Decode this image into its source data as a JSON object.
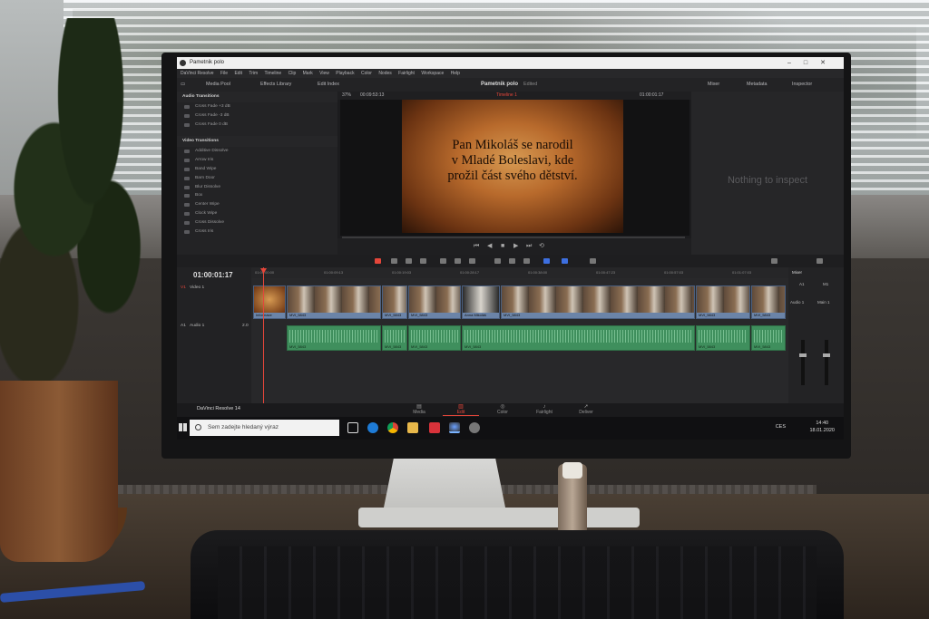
{
  "app": {
    "window_title": "Pametnik polo",
    "project_name": "Pametnik polo",
    "project_status": "Edited",
    "app_name": "DaVinci Resolve 14"
  },
  "menu": [
    "DaVinci Resolve",
    "File",
    "Edit",
    "Trim",
    "Timeline",
    "Clip",
    "Mark",
    "View",
    "Playback",
    "Color",
    "Nodes",
    "Fairlight",
    "Workspace",
    "Help"
  ],
  "toolbar": {
    "media_pool": "Media Pool",
    "effects_library": "Effects Library",
    "edit_index": "Edit Index",
    "mixer": "Mixer",
    "metadata": "Metadata",
    "inspector": "Inspector"
  },
  "effects": {
    "audio_heading": "Audio Transitions",
    "audio_items": [
      "Cross Fade +3 dB",
      "Cross Fade -3 dB",
      "Cross Fade 0 dB"
    ],
    "video_heading": "Video Transitions",
    "video_items": [
      "Additive Dissolve",
      "Arrow Iris",
      "Band Wipe",
      "Barn Door",
      "Blur Dissolve",
      "Box",
      "Center Wipe",
      "Clock Wipe",
      "Cross Dissolve",
      "Cross Iris"
    ]
  },
  "viewer": {
    "zoom": "37%",
    "source_timecode": "00:09:53:13",
    "timeline_name": "Timeline 1",
    "record_timecode": "01:00:01:17",
    "frame_text": [
      "Pan Mikoláš se narodil",
      "v Mladé Boleslavi, kde",
      "prožil část svého dětství."
    ]
  },
  "inspector": {
    "empty_text": "Nothing to inspect"
  },
  "timeline": {
    "timecode": "01:00:01:17",
    "video_track": "Video 1",
    "video_track_id": "V1",
    "audio_track": "Audio 1",
    "audio_track_id": "A1",
    "audio_track_level": "2.0",
    "ruler": [
      "01:00:00:00",
      "01:00:09:13",
      "01:00:19:03",
      "01:00:28:17",
      "01:00:38:00",
      "01:00:47:23",
      "01:00:57:03",
      "01:01:07:03"
    ],
    "video_clips": [
      "Informace",
      "MVI_5843",
      "MVI_5843",
      "MVI_5843",
      "Anna Mikoláš",
      "MVI_5843",
      "MVI_5843",
      "MVI_5843"
    ],
    "audio_clips": [
      "MVI_5843",
      "MVI_5843",
      "MVI_5843",
      "MVI_5843",
      "MVI_5843",
      "MVI_5843"
    ]
  },
  "mixer": {
    "title": "Mixer",
    "ch1": "A1",
    "ch2": "M1",
    "ch1_name": "Audio 1",
    "ch2_name": "Main 1"
  },
  "pages": [
    {
      "label": "Media",
      "icon": "▤"
    },
    {
      "label": "Edit",
      "icon": "▥"
    },
    {
      "label": "Color",
      "icon": "◎"
    },
    {
      "label": "Fairlight",
      "icon": "♪"
    },
    {
      "label": "Deliver",
      "icon": "➚"
    }
  ],
  "taskbar": {
    "search_placeholder": "Sem zadejte hledaný výraz",
    "language": "CES",
    "time": "14:40",
    "date": "18.01.2020"
  },
  "colors": {
    "accent_red": "#e5463a",
    "video_clip": "#6b84a8",
    "audio_clip": "#3f8f5d"
  }
}
